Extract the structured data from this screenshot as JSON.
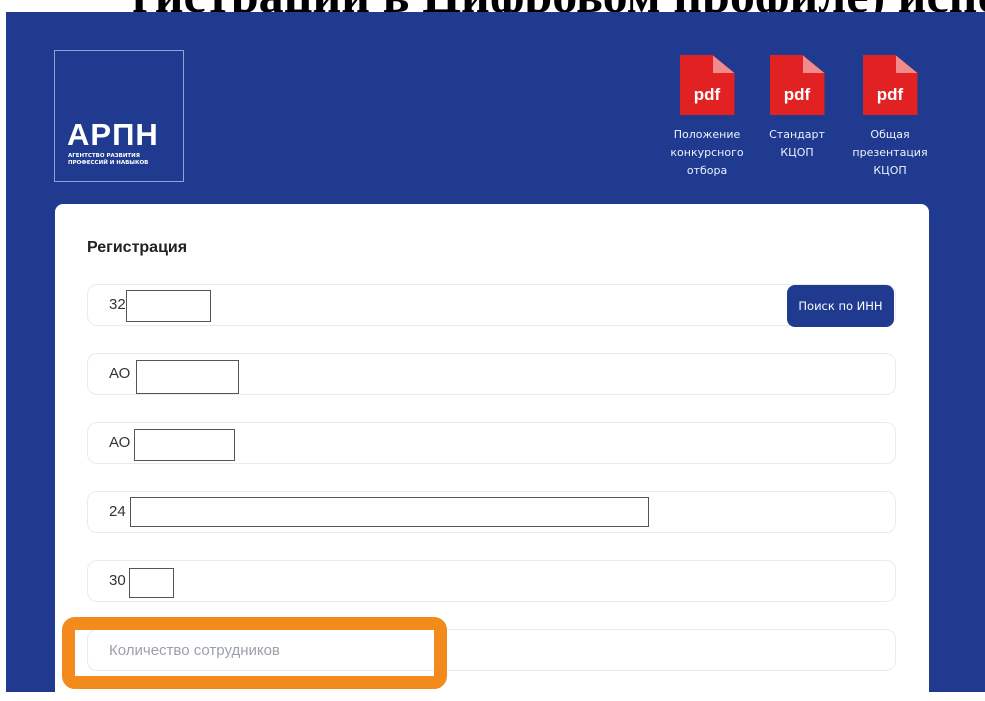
{
  "colors": {
    "page_background": "#1f3a8f",
    "card_background": "#ffffff",
    "button_background": "#1f3a8f",
    "pdf_icon": "#e12122",
    "highlight": "#f28a1c"
  },
  "top_strip": {
    "text": "гистрации в Цифровом профиле) исполь"
  },
  "logo": {
    "title": "АРПН",
    "subtitle": "агентство развития профессий и навыков"
  },
  "documents": [
    {
      "icon_text": "pdf",
      "icon": "pdf-file-icon",
      "label_lines": [
        "Положение",
        "конкурсного",
        "отбора"
      ]
    },
    {
      "icon_text": "pdf",
      "icon": "pdf-file-icon",
      "label_lines": [
        "Стандарт",
        "КЦОП"
      ]
    },
    {
      "icon_text": "pdf",
      "icon": "pdf-file-icon",
      "label_lines": [
        "Общая",
        "презентация",
        "КЦОП"
      ]
    }
  ],
  "form": {
    "title": "Регистрация",
    "inn_value": "32",
    "search_button_label": "Поиск по ИНН",
    "field2_value": "АО",
    "field3_value": "АО",
    "field4_value": "24",
    "field5_value": "30",
    "employees_placeholder": "Количество сотрудников",
    "employees_value": ""
  }
}
